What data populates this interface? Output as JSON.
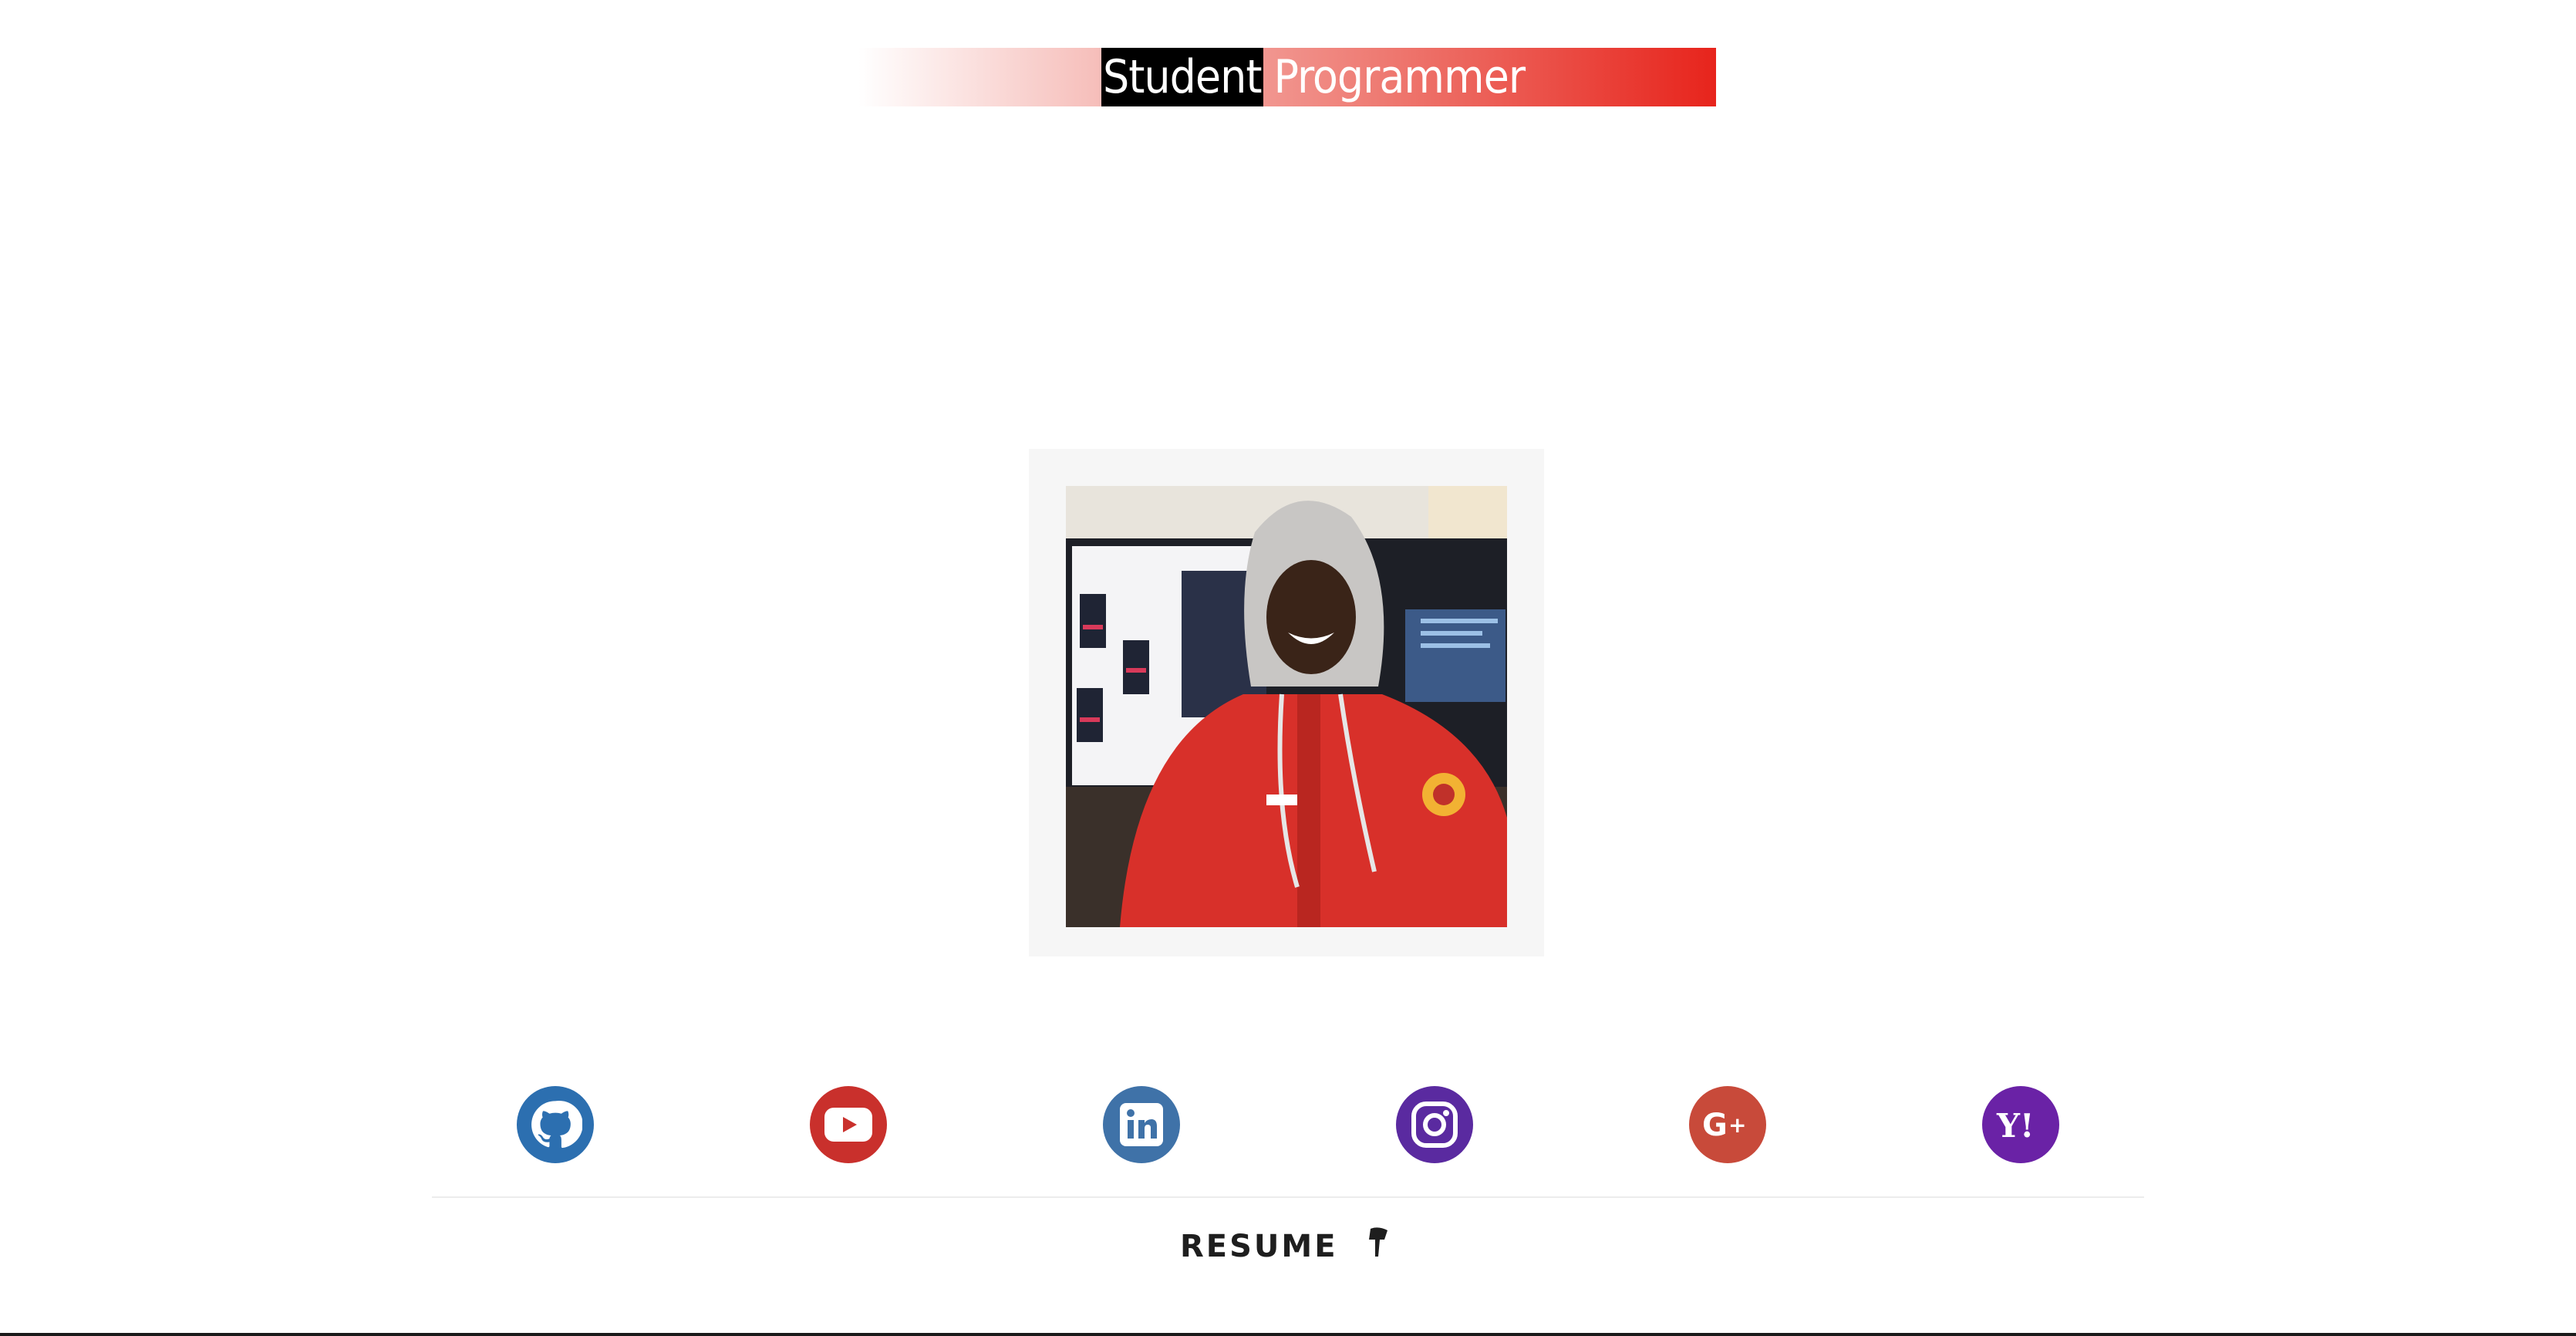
{
  "header": {
    "brand_word1": "Student",
    "brand_word2": "Programmer",
    "gradient_end_color": "#e7241c"
  },
  "profile": {
    "photo_icon": "profile-photo",
    "hoodie_color": "#d8302a"
  },
  "social": {
    "items": [
      {
        "name": "github",
        "color": "#2c6fb0"
      },
      {
        "name": "youtube",
        "color": "#c9302c"
      },
      {
        "name": "linkedin",
        "color": "#3f72a8"
      },
      {
        "name": "instagram",
        "color": "#5a2aa0"
      },
      {
        "name": "google-plus",
        "color": "#c84a3a"
      },
      {
        "name": "yahoo",
        "color": "#6a22a6"
      }
    ]
  },
  "footer": {
    "resume_label": "RESUME",
    "resume_icon": "pin-icon"
  }
}
